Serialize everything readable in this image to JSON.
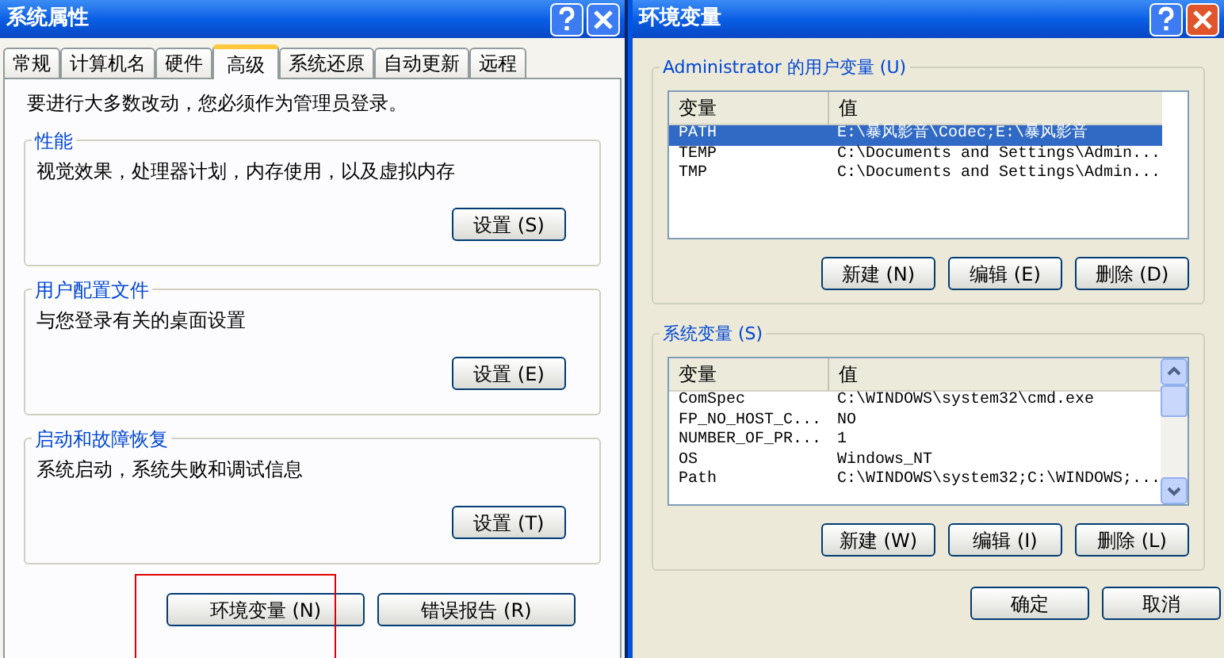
{
  "system_properties": {
    "title": "系统属性",
    "tabs": [
      {
        "label": "常规",
        "selected": false
      },
      {
        "label": "计算机名",
        "selected": false
      },
      {
        "label": "硬件",
        "selected": false
      },
      {
        "label": "高级",
        "selected": true
      },
      {
        "label": "系统还原",
        "selected": false
      },
      {
        "label": "自动更新",
        "selected": false
      },
      {
        "label": "远程",
        "selected": false
      }
    ],
    "notice": "要进行大多数改动，您必须作为管理员登录。",
    "groups": [
      {
        "title": "性能",
        "description": "视觉效果，处理器计划，内存使用，以及虚拟内存",
        "button": "设置 (S)"
      },
      {
        "title": "用户配置文件",
        "description": "与您登录有关的桌面设置",
        "button": "设置 (E)"
      },
      {
        "title": "启动和故障恢复",
        "description": "系统启动，系统失败和调试信息",
        "button": "设置 (T)"
      }
    ],
    "buttons": [
      {
        "label": "环境变量 (N)",
        "highlighted": true
      },
      {
        "label": "错误报告 (R)",
        "highlighted": false
      }
    ]
  },
  "environment_variables": {
    "title": "环境变量",
    "lists": [
      {
        "label": "Administrator 的用户变量 (U)",
        "columns": [
          "变量",
          "值"
        ],
        "scrollbar": false,
        "rows": [
          {
            "name": "PATH",
            "value": "E:\\暴风影音\\Codec;E:\\暴风影音",
            "selected": true
          },
          {
            "name": "TEMP",
            "value": "C:\\Documents and Settings\\Admin...",
            "selected": false
          },
          {
            "name": "TMP",
            "value": "C:\\Documents and Settings\\Admin...",
            "selected": false
          }
        ],
        "buttons": [
          "新建 (N)",
          "编辑 (E)",
          "删除 (D)"
        ]
      },
      {
        "label": "系统变量 (S)",
        "columns": [
          "变量",
          "值"
        ],
        "scrollbar": true,
        "rows": [
          {
            "name": "ComSpec",
            "value": "C:\\WINDOWS\\system32\\cmd.exe",
            "selected": false
          },
          {
            "name": "FP_NO_HOST_C...",
            "value": "NO",
            "selected": false
          },
          {
            "name": "NUMBER_OF_PR...",
            "value": "1",
            "selected": false
          },
          {
            "name": "OS",
            "value": "Windows_NT",
            "selected": false
          },
          {
            "name": "Path",
            "value": "C:\\WINDOWS\\system32;C:\\WINDOWS;...",
            "selected": false
          }
        ],
        "buttons": [
          "新建 (W)",
          "编辑 (I)",
          "删除 (L)"
        ]
      }
    ],
    "buttons": [
      "确定",
      "取消"
    ]
  }
}
